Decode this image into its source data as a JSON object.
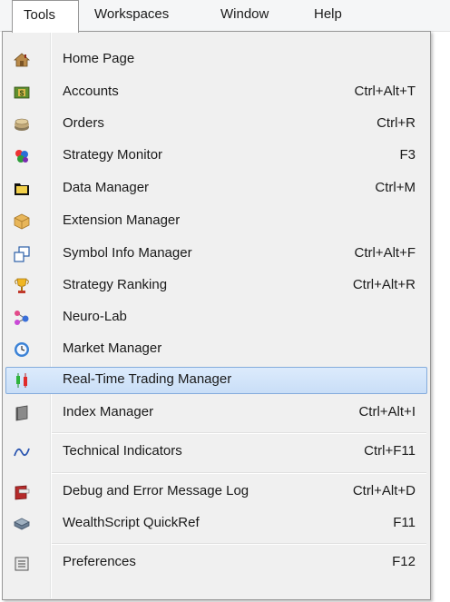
{
  "menubar": {
    "items": [
      {
        "label": "Tools"
      },
      {
        "label": "Workspaces"
      },
      {
        "label": "Window"
      },
      {
        "label": "Help"
      }
    ]
  },
  "menu": {
    "items": [
      {
        "label": "Home Page",
        "shortcut": "",
        "icon": "home-icon"
      },
      {
        "label": "Accounts",
        "shortcut": "Ctrl+Alt+T",
        "icon": "dollar-icon"
      },
      {
        "label": "Orders",
        "shortcut": "Ctrl+R",
        "icon": "orders-icon"
      },
      {
        "label": "Strategy Monitor",
        "shortcut": "F3",
        "icon": "strategy-monitor-icon"
      },
      {
        "label": "Data Manager",
        "shortcut": "Ctrl+M",
        "icon": "folder-icon"
      },
      {
        "label": "Extension Manager",
        "shortcut": "",
        "icon": "package-icon"
      },
      {
        "label": "Symbol Info Manager",
        "shortcut": "Ctrl+Alt+F",
        "icon": "windows-icon"
      },
      {
        "label": "Strategy Ranking",
        "shortcut": "Ctrl+Alt+R",
        "icon": "trophy-icon"
      },
      {
        "label": "Neuro-Lab",
        "shortcut": "",
        "icon": "neural-network-icon"
      },
      {
        "label": "Market Manager",
        "shortcut": "",
        "icon": "clock-icon"
      },
      {
        "label": "Real-Time Trading Manager",
        "shortcut": "",
        "icon": "candlestick-icon"
      },
      {
        "label": "Index Manager",
        "shortcut": "Ctrl+Alt+I",
        "icon": "book-icon"
      },
      {
        "label": "Technical Indicators",
        "shortcut": "Ctrl+F11",
        "icon": "wave-icon"
      },
      {
        "label": "Debug and Error Message Log",
        "shortcut": "Ctrl+Alt+D",
        "icon": "log-book-icon"
      },
      {
        "label": "WealthScript QuickRef",
        "shortcut": "F11",
        "icon": "quickref-icon"
      },
      {
        "label": "Preferences",
        "shortcut": "F12",
        "icon": "preferences-icon"
      }
    ]
  },
  "colors": {
    "highlight_bg": "#cfe3fb",
    "highlight_border": "#84acdd",
    "menu_bg": "#f0f0f0"
  }
}
